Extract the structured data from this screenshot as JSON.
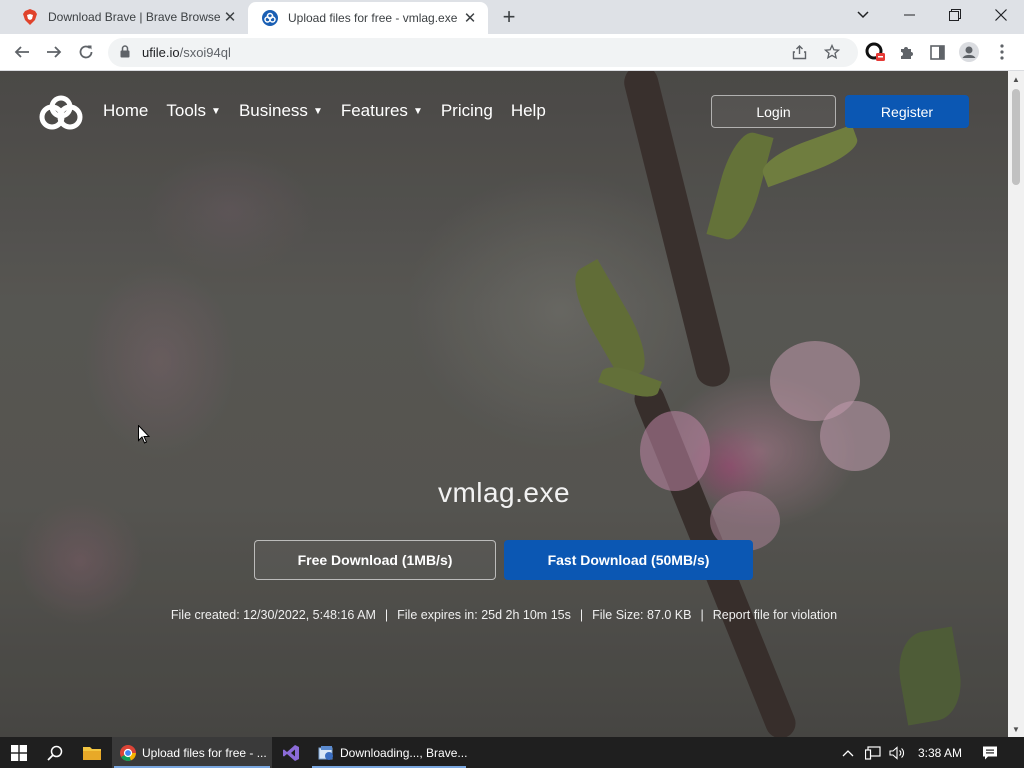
{
  "browser": {
    "tabs": [
      {
        "title": "Download Brave | Brave Browser",
        "icon": "brave-lion-icon",
        "active": false
      },
      {
        "title": "Upload files for free - vmlag.exe",
        "icon": "ufile-logo-icon",
        "active": true
      }
    ],
    "url": {
      "host": "ufile.io",
      "path": "/sxoi94ql"
    }
  },
  "site": {
    "nav": [
      {
        "label": "Home",
        "dropdown": false
      },
      {
        "label": "Tools",
        "dropdown": true
      },
      {
        "label": "Business",
        "dropdown": true
      },
      {
        "label": "Features",
        "dropdown": true
      },
      {
        "label": "Pricing",
        "dropdown": false
      },
      {
        "label": "Help",
        "dropdown": false
      }
    ],
    "login_label": "Login",
    "register_label": "Register",
    "accent": "#0b57b3"
  },
  "file": {
    "name": "vmlag.exe",
    "free_download_label": "Free Download (1MB/s)",
    "fast_download_label": "Fast Download (50MB/s)",
    "created": "File created: 12/30/2022, 5:48:16 AM",
    "expires": "File expires in: 25d 2h 10m 15s",
    "size": "File Size: 87.0 KB",
    "report": "Report file for violation",
    "separator": "|"
  },
  "taskbar": {
    "apps": [
      {
        "label": "Upload files for free - ...",
        "icon": "chrome-icon",
        "active": true
      },
      {
        "label": "",
        "icon": "visual-studio-icon",
        "active": false
      },
      {
        "label": "Downloading..., Brave...",
        "icon": "brave-installer-icon",
        "active": false
      }
    ],
    "clock": "3:38 AM"
  }
}
